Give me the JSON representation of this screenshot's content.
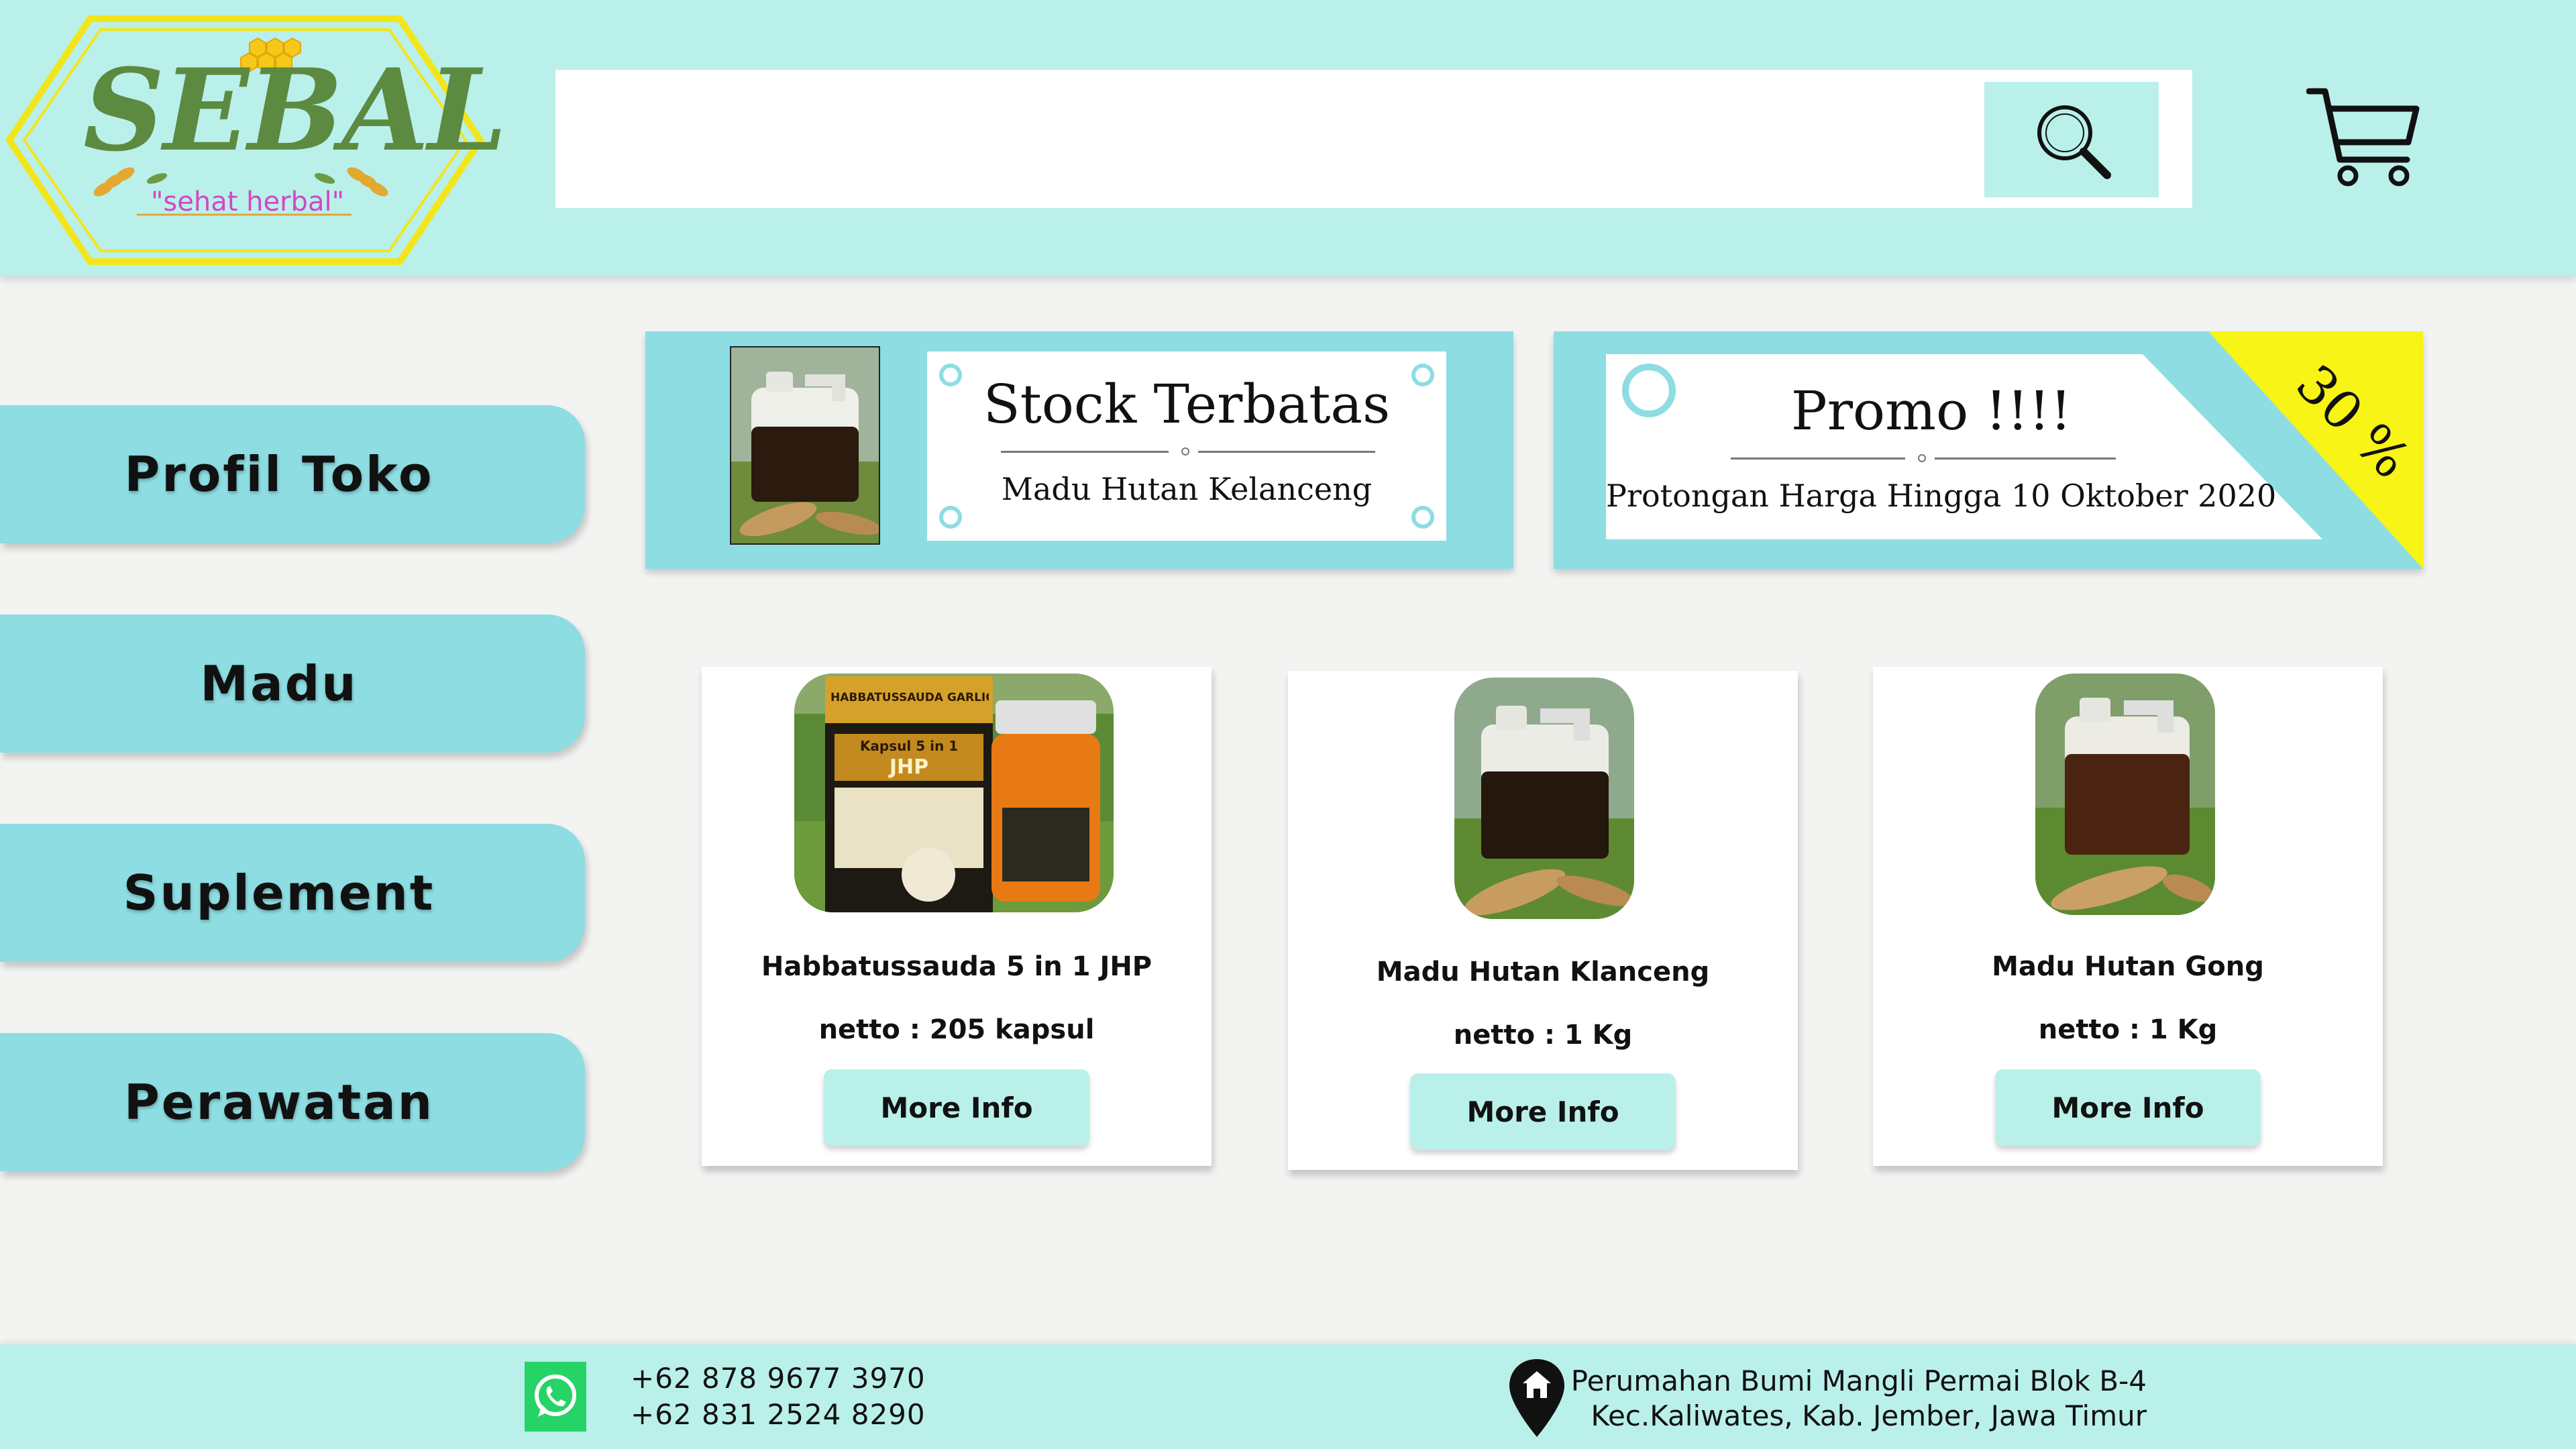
{
  "header": {
    "logo": {
      "name": "SEBAL",
      "tagline": "\"sehat herbal\""
    },
    "search": {
      "placeholder": ""
    },
    "search_icon": "search-icon",
    "cart_icon": "cart-icon"
  },
  "sidebar": {
    "items": [
      {
        "label": "Profil Toko"
      },
      {
        "label": "Madu"
      },
      {
        "label": "Suplement"
      },
      {
        "label": "Perawatan"
      }
    ]
  },
  "banners": {
    "stock": {
      "title": "Stock Terbatas",
      "subtitle": "Madu Hutan Kelanceng"
    },
    "promo": {
      "title": "Promo !!!!",
      "subtitle": "Protongan Harga Hingga 10 Oktober 2020",
      "badge": "30 %"
    }
  },
  "products": [
    {
      "name": "Habbatussauda 5 in 1 JHP",
      "netto": "netto : 205 kapsul",
      "button": "More Info"
    },
    {
      "name": "Madu Hutan Klanceng",
      "netto": "netto : 1 Kg",
      "button": "More Info"
    },
    {
      "name": "Madu Hutan Gong",
      "netto": "netto : 1 Kg",
      "button": "More Info"
    }
  ],
  "product_box_label": {
    "brand": "HABBATUSSAUDA GARLIC",
    "line": "Kapsul 5 in 1",
    "mark": "JHP"
  },
  "footer": {
    "phones": [
      "+62 878 9677 3970",
      "+62 831 2524 8290"
    ],
    "address": [
      "Perumahan Bumi Mangli Permai Blok B-4",
      "Kec.Kaliwates, Kab. Jember, Jawa Timur"
    ],
    "whatsapp_icon": "whatsapp-icon",
    "location_icon": "location-pin-icon"
  },
  "colors": {
    "header_bg": "#baf0ea",
    "accent": "#8ddde2",
    "promo_badge": "#f7f416",
    "logo_green": "#5c8a40",
    "logo_pink": "#d246c6"
  }
}
